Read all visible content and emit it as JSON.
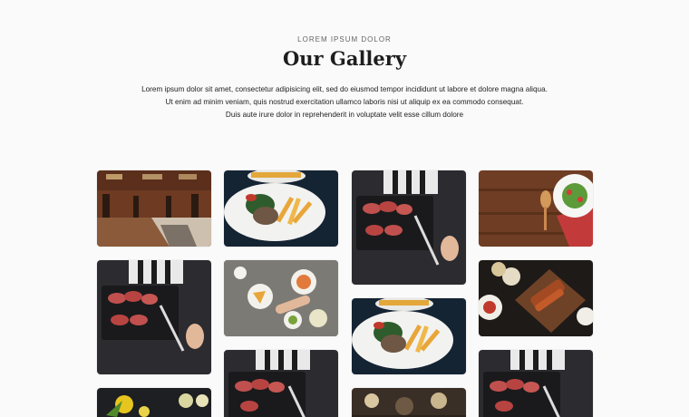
{
  "section": {
    "eyebrow": "LOREM IPSUM DOLOR",
    "title": "Our Gallery",
    "description": [
      "Lorem ipsum dolor sit amet, consectetur adipisicing elit, sed do eiusmod tempor incididunt ut labore et dolore magna aliqua.",
      "Ut enim ad minim veniam, quis nostrud exercitation ullamco laboris nisi ut aliquip ex ea commodo consequat.",
      "Duis aute irure dolor in reprehenderit in voluptate velit esse cillum dolore"
    ]
  },
  "gallery": {
    "photos": [
      {
        "subject": "restaurant-interior"
      },
      {
        "subject": "steak-and-fries-plate"
      },
      {
        "subject": "sliced-steak-board"
      },
      {
        "subject": "salad-on-wood-table"
      },
      {
        "subject": "sliced-steak-board"
      },
      {
        "subject": "shared-dishes-table"
      },
      {
        "subject": "steak-and-fries-plate"
      },
      {
        "subject": "grilled-ribs-board"
      },
      {
        "subject": "lemon-and-greens"
      },
      {
        "subject": "sliced-steak-board"
      },
      {
        "subject": "dark-table-dishes"
      },
      {
        "subject": "sliced-steak-board"
      }
    ]
  }
}
